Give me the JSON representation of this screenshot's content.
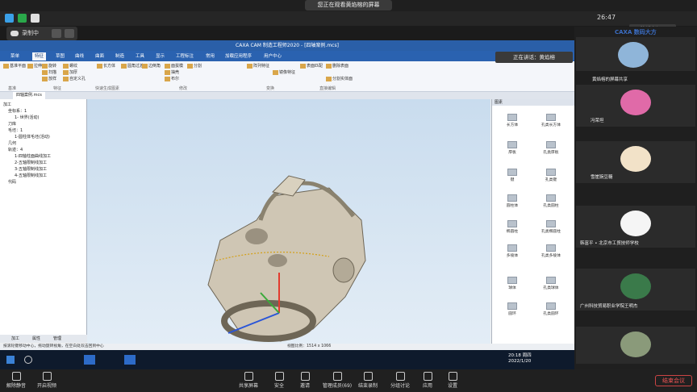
{
  "banner": "您正在观看黄焰榕的屏幕",
  "time": "26:47",
  "view_mode": "演讲者视图",
  "recording": "录制中",
  "app": {
    "title": "CAXA CAM 制造工程师2020 - [四轴案例.mcs]",
    "menus": [
      "菜单",
      "特征",
      "草图",
      "曲线",
      "曲面",
      "制造",
      "工具",
      "显示",
      "工程标注",
      "常用",
      "加载应用程序",
      "用户中心"
    ],
    "active_menu": "特征",
    "ribbon": [
      {
        "label": "基准平面"
      },
      {
        "label": "拉伸"
      },
      {
        "label": "旋转"
      },
      {
        "label": "扫描"
      },
      {
        "label": "放样"
      },
      {
        "label": "螺纹"
      },
      {
        "label": "加厚"
      },
      {
        "label": "自定义孔"
      },
      {
        "label": "长方体"
      },
      {
        "label": "圆角过渡"
      },
      {
        "label": "边倒角"
      },
      {
        "label": "面拔模"
      },
      {
        "label": "抽壳"
      },
      {
        "label": "布尔"
      },
      {
        "label": "分割"
      },
      {
        "label": "阵列特征"
      },
      {
        "label": "镜像特征"
      },
      {
        "label": "删除表面"
      },
      {
        "label": "表面匹配"
      },
      {
        "label": "分割实体面"
      }
    ],
    "groups": [
      "基准",
      "特征",
      "快速生成图素",
      "修改",
      "变换",
      "直接编辑"
    ],
    "doc_tab": "四轴案例.mcs",
    "tree": [
      "加工",
      "坐标系：1",
      "1- 世界(活动)",
      "刀库",
      "毛坯：1",
      "1-圆柱体毛坯(活动)",
      "几何",
      "轨迹：4",
      "1-四轴柱面曲线加工",
      "2-五轴限制线加工",
      "3-五轴限制线加工",
      "4-五轴限制线加工",
      "代码"
    ],
    "tree_tabs": [
      "加工",
      "属性",
      "管理"
    ],
    "library": [
      "长方体",
      "孔类长方体",
      "厚板",
      "孔类厚板",
      "键",
      "孔类键",
      "圆柱体",
      "孔类圆柱",
      "椭圆柱",
      "孔类椭圆柱",
      "多棱体",
      "孔类多棱体",
      "球体",
      "孔类球体",
      "圆环",
      "孔类圆环"
    ],
    "library_header": "图素",
    "status": "按滚轮键移动中心，拖动旋转视角，在空白处双击回到中心",
    "viewsize": "视图比例：1514 x 1066",
    "clock": "20:18 周四",
    "date": "2022/1/20"
  },
  "participants": [
    {
      "name": "正在讲话：黄焰榕"
    },
    {
      "name": "黄焰榕的屏幕共享"
    },
    {
      "name": "冯荣坦"
    },
    {
      "name": "雪崖豌豆糖"
    },
    {
      "name": "韩富平 • 北京市工贸技师学校"
    },
    {
      "name": "广州科技贸易职业学院王明杰"
    }
  ],
  "brand": "CAXA 数码大方",
  "bottom": [
    {
      "label": "解除静音"
    },
    {
      "label": "开启视频"
    },
    {
      "label": "共享屏幕"
    },
    {
      "label": "安全"
    },
    {
      "label": "邀请"
    },
    {
      "label": "管理成员(69)"
    },
    {
      "label": "结束录制"
    },
    {
      "label": "分组讨论"
    },
    {
      "label": "应用"
    },
    {
      "label": "设置"
    }
  ],
  "end_meeting": "结束会议"
}
